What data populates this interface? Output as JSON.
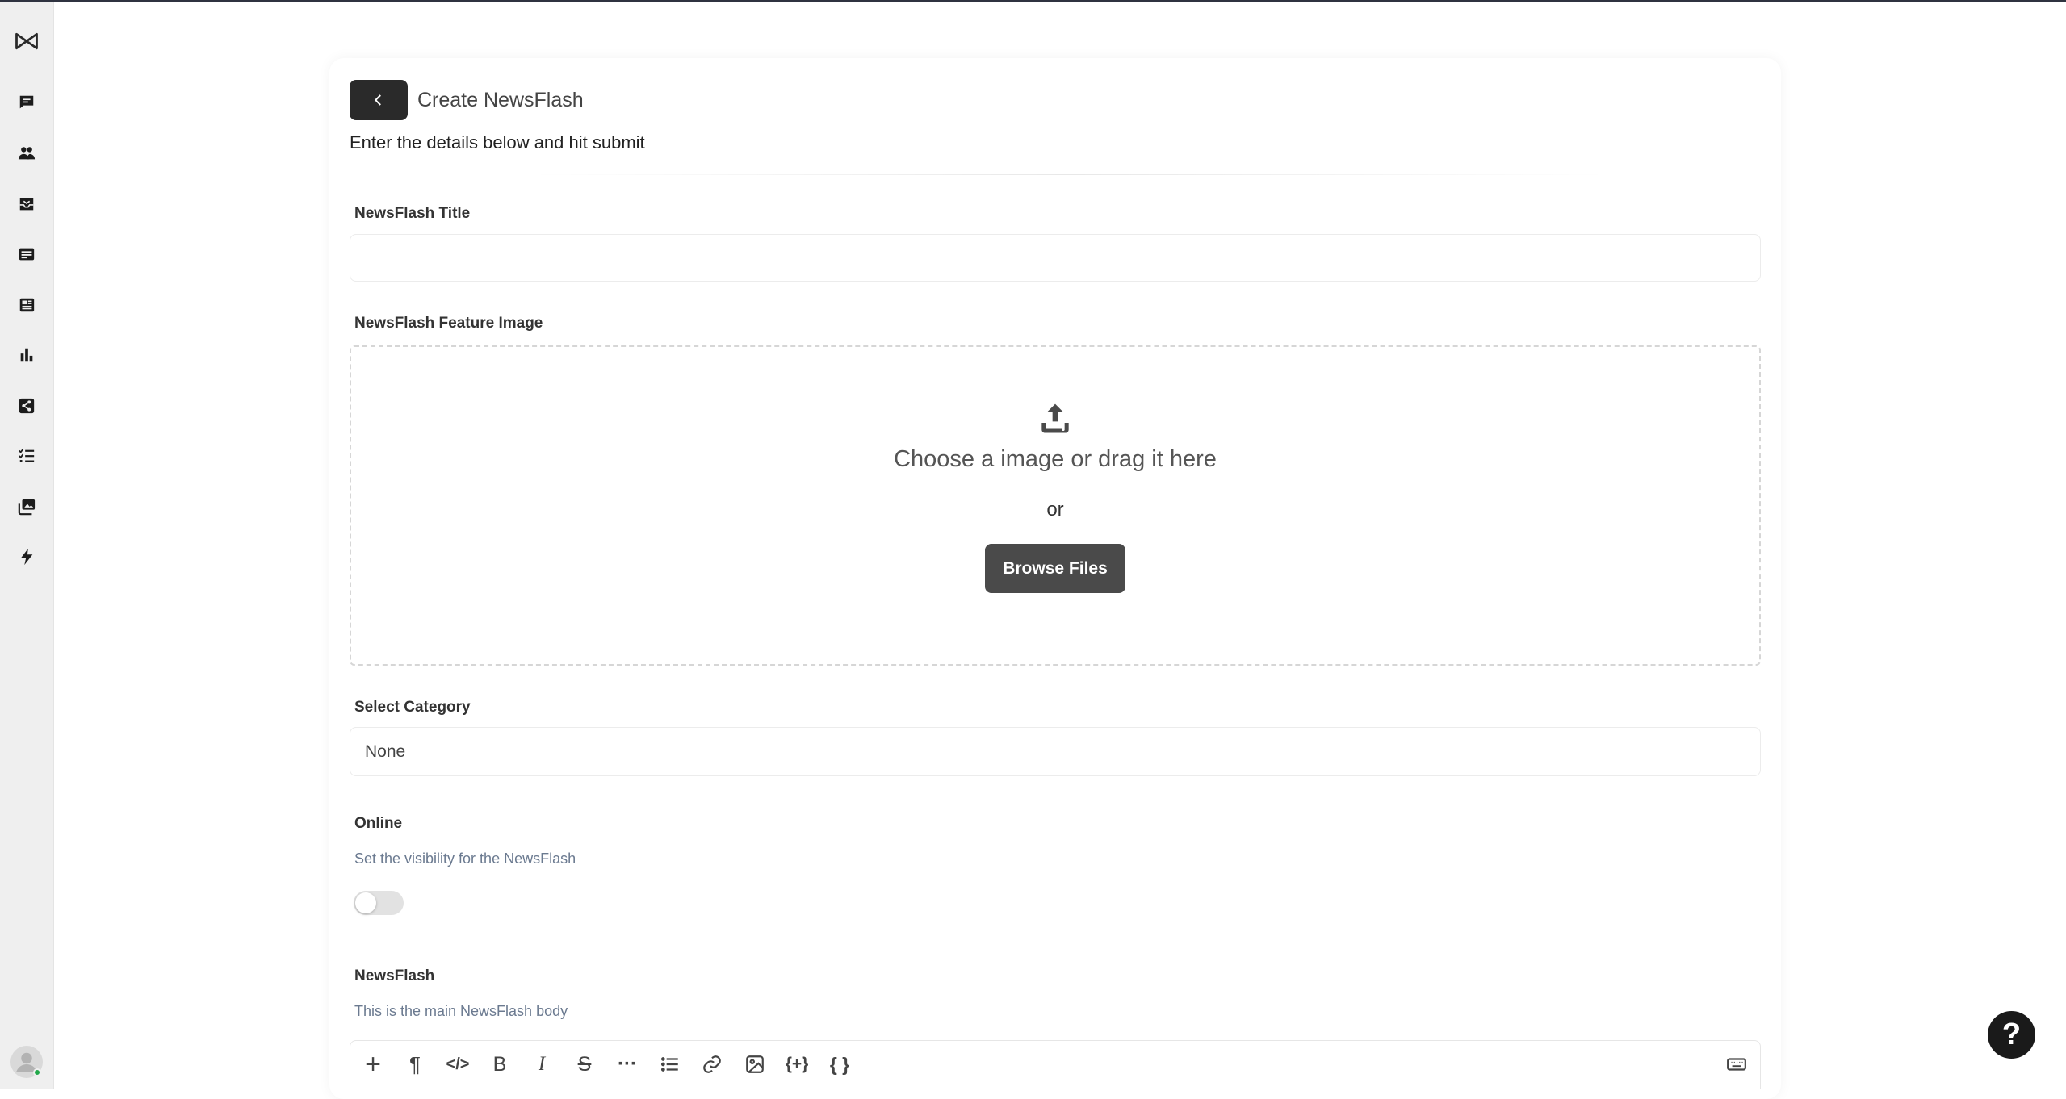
{
  "header": {
    "title": "Create NewsFlash",
    "subtitle": "Enter the details below and hit submit"
  },
  "sidebar": {
    "items": [
      {
        "icon": "chat-icon"
      },
      {
        "icon": "users-icon"
      },
      {
        "icon": "inbox-icon"
      },
      {
        "icon": "card-icon"
      },
      {
        "icon": "newspaper-icon"
      },
      {
        "icon": "bar-chart-icon"
      },
      {
        "icon": "share-icon"
      },
      {
        "icon": "checklist-icon"
      },
      {
        "icon": "gallery-icon"
      },
      {
        "icon": "bolt-icon"
      }
    ]
  },
  "form": {
    "title_label": "NewsFlash Title",
    "title_value": "",
    "image_label": "NewsFlash Feature Image",
    "dropzone_title": "Choose a image or drag it here",
    "dropzone_or": "or",
    "browse_label": "Browse Files",
    "category_label": "Select Category",
    "category_value": "None",
    "online_label": "Online",
    "online_help": "Set the visibility for the NewsFlash",
    "online_value": false,
    "body_label": "NewsFlash",
    "body_help": "This is the main NewsFlash body"
  },
  "editor": {
    "toolbar": {
      "add": "+",
      "paragraph": "¶",
      "code": "</>",
      "bold": "B",
      "italic": "I",
      "strike": "S",
      "more": "···",
      "variable": "{+}",
      "braces": "{ }"
    }
  },
  "help_button": "?",
  "colors": {
    "accent_dark": "#2a2a2a",
    "button_gray": "#4a4a4a",
    "help_text": "#6b7a90",
    "online_dot": "#22a84a"
  }
}
